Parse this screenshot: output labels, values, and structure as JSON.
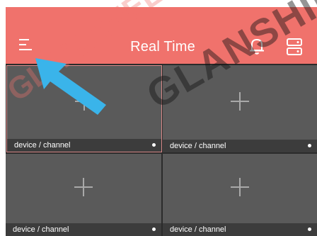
{
  "header": {
    "title": "Real Time",
    "menu_icon": "menu-icon",
    "bell_icon": "bell-icon",
    "devices_icon": "device-list-icon",
    "color": "#f0726c"
  },
  "grid": {
    "cells": [
      {
        "label": "device / channel",
        "add_icon": "plus-icon"
      },
      {
        "label": "device / channel",
        "add_icon": "plus-icon"
      },
      {
        "label": "device / channel",
        "add_icon": "plus-icon"
      },
      {
        "label": "device / channel",
        "add_icon": "plus-icon"
      }
    ]
  },
  "overlay": {
    "watermark": "GLANSHIELD",
    "arrow_color": "#3ab4ea"
  }
}
